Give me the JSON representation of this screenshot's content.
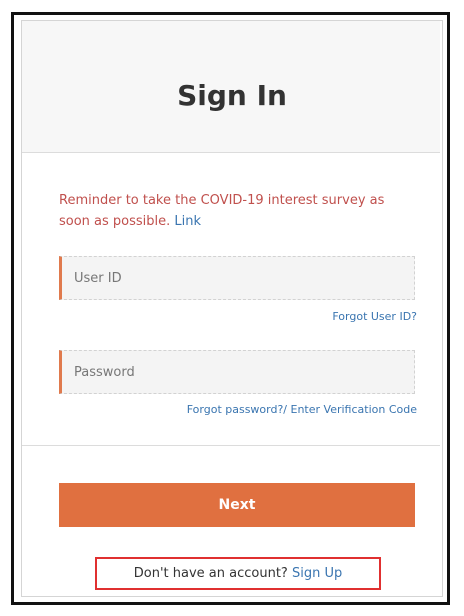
{
  "header": {
    "title": "Sign In"
  },
  "reminder": {
    "text": "Reminder to take the COVID-19 interest survey as soon as possible.",
    "link_label": "Link"
  },
  "form": {
    "user_id": {
      "value": "",
      "placeholder": "User ID"
    },
    "forgot_user_id": "Forgot User ID?",
    "password": {
      "value": "",
      "placeholder": "Password"
    },
    "forgot_password": "Forgot password?/ Enter Verification Code",
    "next_label": "Next"
  },
  "footer": {
    "no_account_text": "Don't have an account?",
    "sign_up_label": "Sign Up"
  },
  "colors": {
    "accent": "#e07040",
    "reminder": "#c0504d",
    "link": "#3a75b0",
    "highlight_box": "#e03030"
  }
}
